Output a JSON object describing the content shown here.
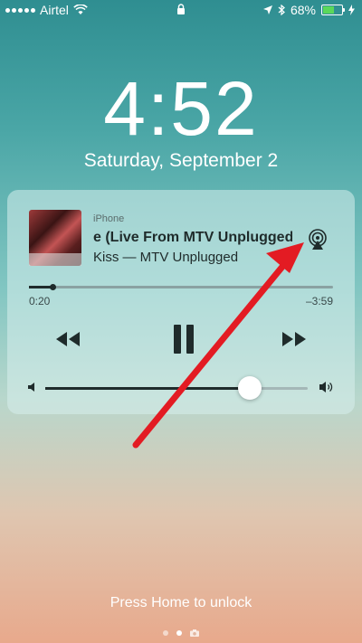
{
  "status_bar": {
    "carrier": "Airtel",
    "battery_percent": "68%",
    "battery_level": 0.68,
    "battery_color": "#5bd85a"
  },
  "lock_screen": {
    "time": "4:52",
    "date": "Saturday, September 2",
    "unlock_hint": "Press Home to unlock"
  },
  "now_playing": {
    "device": "iPhone",
    "song_title": "e (Live From MTV Unplugged",
    "artist_album": "Kiss — MTV Unplugged",
    "elapsed": "0:20",
    "remaining": "–3:59",
    "progress": 0.077,
    "volume": 0.78,
    "icons": [
      "airplay-icon",
      "rewind-icon",
      "pause-icon",
      "fast-forward-icon",
      "volume-low-icon",
      "volume-high-icon"
    ]
  },
  "annotation": {
    "arrow_color": "#e31b23"
  },
  "pager": {
    "pages": 3,
    "active_index": 1
  }
}
